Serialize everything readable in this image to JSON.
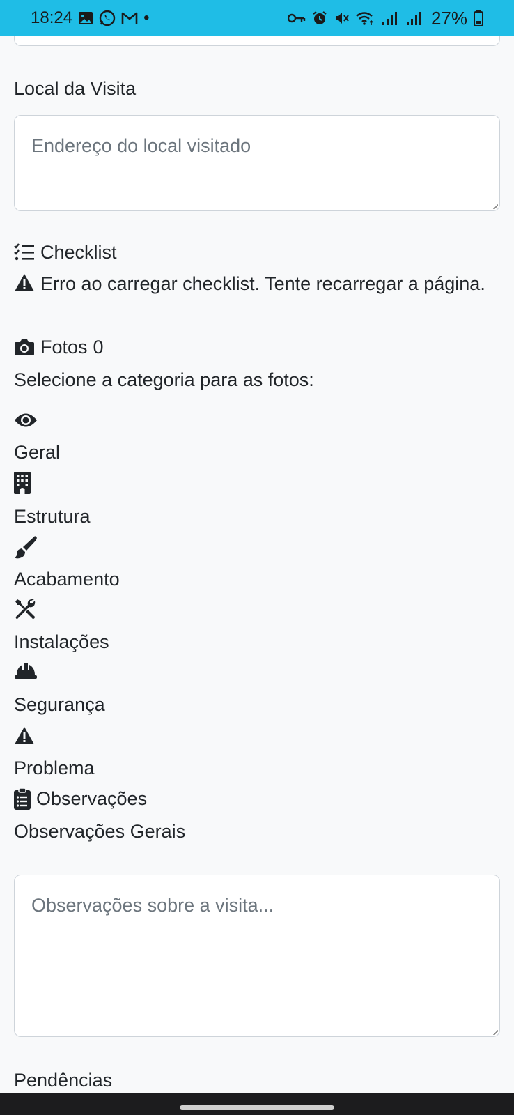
{
  "status_bar": {
    "time": "18:24",
    "dot": "•",
    "battery_percent": "27%",
    "background_color": "#1fbde6"
  },
  "visit_location": {
    "label": "Local da Visita",
    "placeholder": "Endereço do local visitado"
  },
  "checklist": {
    "title": "Checklist",
    "error_message": "Erro ao carregar checklist. Tente recarregar a página."
  },
  "photos": {
    "title": "Fotos",
    "count": "0",
    "select_category_prompt": "Selecione a categoria para as fotos:",
    "categories": [
      {
        "icon": "eye-icon",
        "label": "Geral"
      },
      {
        "icon": "building-icon",
        "label": "Estrutura"
      },
      {
        "icon": "paintbrush-icon",
        "label": "Acabamento"
      },
      {
        "icon": "tools-icon",
        "label": "Instalações"
      },
      {
        "icon": "hard-hat-icon",
        "label": "Segurança"
      },
      {
        "icon": "warning-icon",
        "label": "Problema"
      }
    ]
  },
  "observations": {
    "title": "Observações",
    "general_label": "Observações Gerais",
    "placeholder": "Observações sobre a visita..."
  },
  "pendencies": {
    "label": "Pendências"
  }
}
